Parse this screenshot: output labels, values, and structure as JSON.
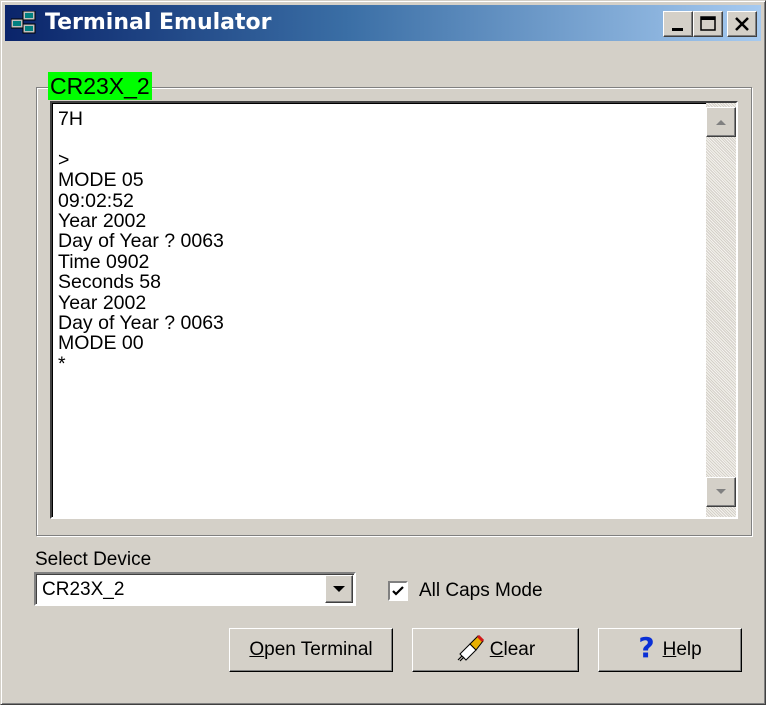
{
  "window": {
    "title": "Terminal Emulator",
    "title_gradient": [
      "#0a246a",
      "#a6caf0"
    ],
    "caption_buttons": [
      "minimize-icon",
      "maximize-icon",
      "close-icon"
    ]
  },
  "terminal": {
    "group_label": "CR23X_2",
    "group_label_color": "#00ff00",
    "lines": [
      "7H",
      "",
      ">",
      "MODE 05",
      "09:02:52",
      "Year 2002",
      "Day of Year ? 0063",
      "Time 0902",
      "Seconds 58",
      "Year 2002",
      "Day of Year ? 0063",
      "MODE 00",
      "*"
    ]
  },
  "device": {
    "label": "Select Device",
    "selected": "CR23X_2"
  },
  "all_caps": {
    "label": "All Caps Mode",
    "checked": true
  },
  "buttons": {
    "open_terminal": {
      "mnemonic": "O",
      "rest": "pen Terminal"
    },
    "clear": {
      "mnemonic": "C",
      "rest": "lear",
      "icon": "eraser-icon"
    },
    "help": {
      "mnemonic": "H",
      "rest": "elp",
      "icon": "question-mark-icon",
      "icon_glyph": "?"
    }
  }
}
